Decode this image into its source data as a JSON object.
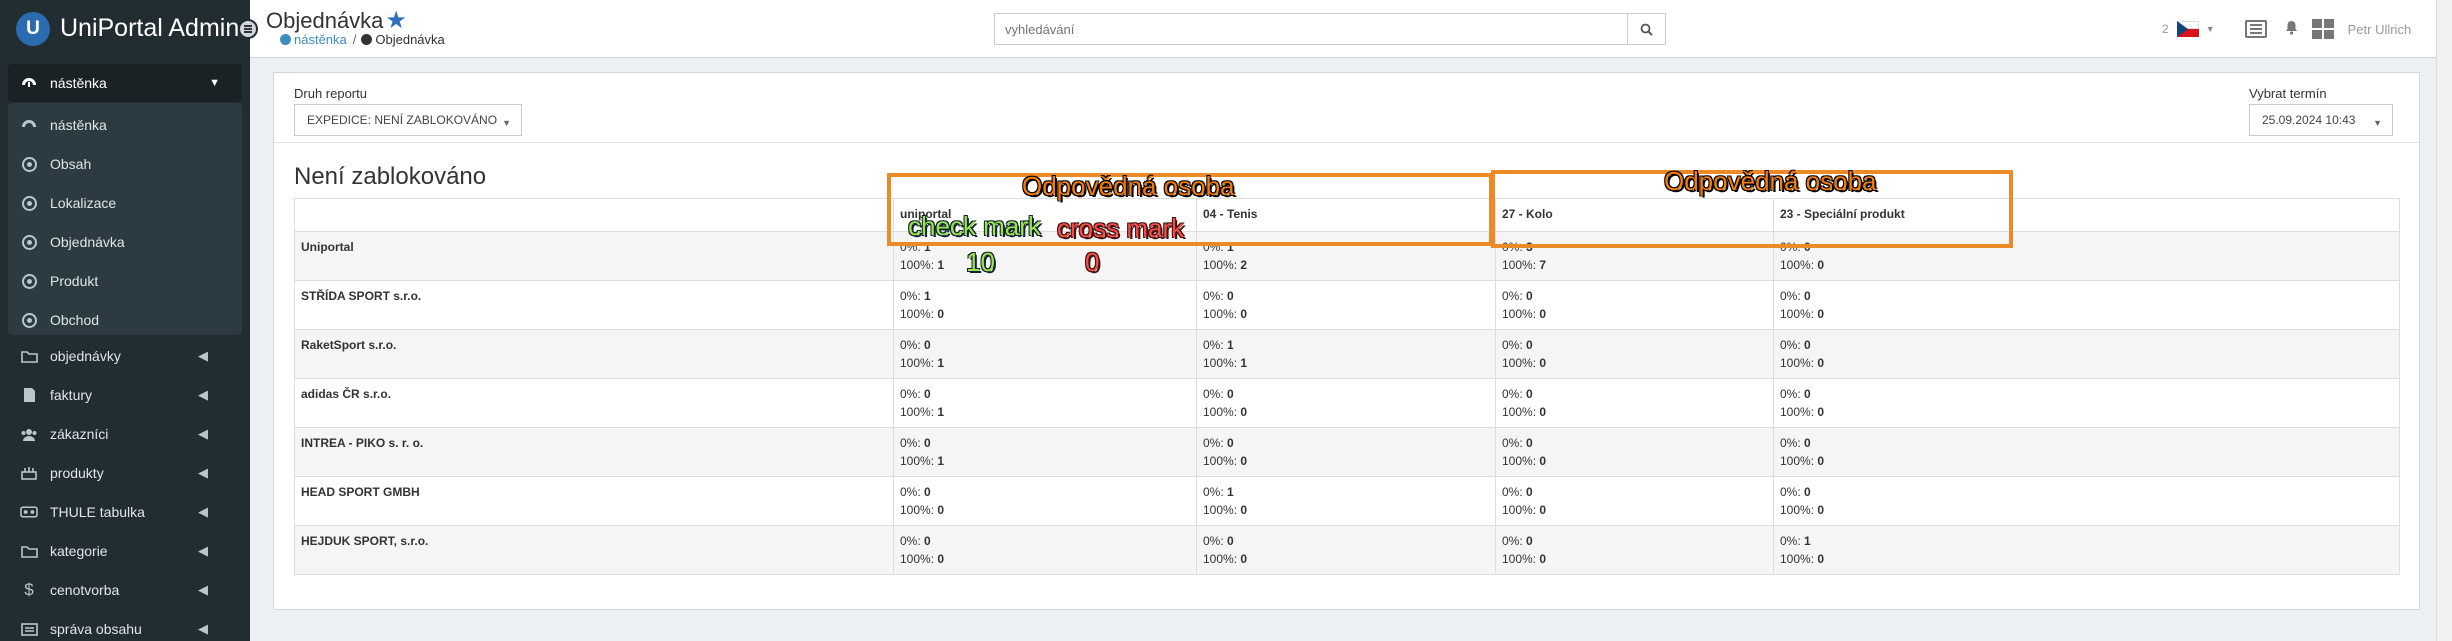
{
  "app": {
    "title": "UniPortal Admin",
    "logo_letter": "U"
  },
  "sidebar": {
    "active": {
      "label": "nástěnka",
      "icon": "dashboard-icon"
    },
    "subitems": [
      {
        "label": "nástěnka",
        "icon": "dashboard-icon"
      },
      {
        "label": "Obsah",
        "icon": "circle-icon"
      },
      {
        "label": "Lokalizace",
        "icon": "circle-icon"
      },
      {
        "label": "Objednávka",
        "icon": "circle-icon"
      },
      {
        "label": "Produkt",
        "icon": "circle-icon"
      },
      {
        "label": "Obchod",
        "icon": "circle-icon"
      }
    ],
    "items": [
      {
        "label": "objednávky",
        "icon": "folder-icon"
      },
      {
        "label": "faktury",
        "icon": "invoice-icon"
      },
      {
        "label": "zákazníci",
        "icon": "users-icon"
      },
      {
        "label": "produkty",
        "icon": "products-icon"
      },
      {
        "label": "THULE tabulka",
        "icon": "thule-icon"
      },
      {
        "label": "kategorie",
        "icon": "folder-icon"
      },
      {
        "label": "cenotvorba",
        "icon": "dollar-icon"
      },
      {
        "label": "správa obsahu",
        "icon": "content-icon"
      }
    ]
  },
  "header": {
    "page_title": "Objednávka",
    "breadcrumb": {
      "home": "nástěnka",
      "separator": "/",
      "current": "Objednávka"
    },
    "search": {
      "placeholder": "vyhledávání",
      "value": ""
    },
    "language_count": "2",
    "user_name": "Petr Ullrich"
  },
  "filters": {
    "report_type_label": "Druh reportu",
    "report_type_value": "EXPEDICE: NENÍ ZABLOKOVÁNO",
    "term_label": "Vybrat termín",
    "term_value": "25.09.2024 10:43"
  },
  "report": {
    "title": "Není zablokováno",
    "columns": [
      "uniportal",
      "04 - Tenis",
      "27 - Kolo",
      "23 - Speciální produkt"
    ],
    "label_0": "0%: ",
    "label_100": "100%: ",
    "rows": [
      {
        "name": "Uniportal",
        "cells": [
          {
            "a": "1",
            "b": "1"
          },
          {
            "a": "1",
            "b": "2"
          },
          {
            "a": "3",
            "b": "7"
          },
          {
            "a": "0",
            "b": "0"
          }
        ]
      },
      {
        "name": "STŘÍDA SPORT s.r.o.",
        "cells": [
          {
            "a": "1",
            "b": "0"
          },
          {
            "a": "0",
            "b": "0"
          },
          {
            "a": "0",
            "b": "0"
          },
          {
            "a": "0",
            "b": "0"
          }
        ]
      },
      {
        "name": "RaketSport s.r.o.",
        "cells": [
          {
            "a": "0",
            "b": "1"
          },
          {
            "a": "1",
            "b": "1"
          },
          {
            "a": "0",
            "b": "0"
          },
          {
            "a": "0",
            "b": "0"
          }
        ]
      },
      {
        "name": "adidas ČR s.r.o.",
        "cells": [
          {
            "a": "0",
            "b": "1"
          },
          {
            "a": "0",
            "b": "0"
          },
          {
            "a": "0",
            "b": "0"
          },
          {
            "a": "0",
            "b": "0"
          }
        ]
      },
      {
        "name": "INTREA - PIKO s. r. o.",
        "cells": [
          {
            "a": "0",
            "b": "1"
          },
          {
            "a": "0",
            "b": "0"
          },
          {
            "a": "0",
            "b": "0"
          },
          {
            "a": "0",
            "b": "0"
          }
        ]
      },
      {
        "name": "HEAD SPORT GMBH",
        "cells": [
          {
            "a": "0",
            "b": "0"
          },
          {
            "a": "1",
            "b": "0"
          },
          {
            "a": "0",
            "b": "0"
          },
          {
            "a": "0",
            "b": "0"
          }
        ]
      },
      {
        "name": "HEJDUK SPORT, s.r.o.",
        "cells": [
          {
            "a": "0",
            "b": "0"
          },
          {
            "a": "0",
            "b": "0"
          },
          {
            "a": "0",
            "b": "0"
          },
          {
            "a": "1",
            "b": "0"
          }
        ]
      }
    ]
  },
  "annotations": {
    "responsible_person": "Odpovědná osoba",
    "check_mark": "check mark",
    "cross_mark": "cross mark",
    "check_count": "10",
    "cross_count": "0",
    "colors": {
      "orange": "#ec8a28",
      "green": "#9be44a",
      "red": "#f0504a"
    }
  }
}
